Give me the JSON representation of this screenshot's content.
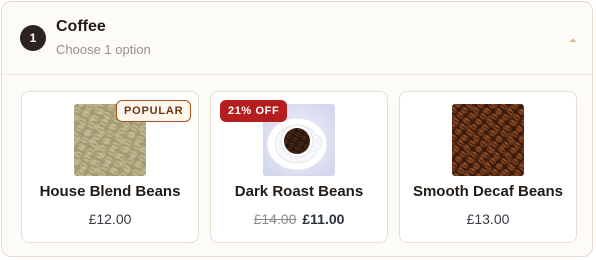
{
  "section": {
    "step_number": "1",
    "title": "Coffee",
    "subtitle": "Choose 1 option",
    "toggle_icon": "chevron-up-icon"
  },
  "products": [
    {
      "name": "House Blend Beans",
      "price": "£12.00",
      "badge": "POPULAR",
      "image": "green-coffee-beans"
    },
    {
      "name": "Dark Roast Beans",
      "old_price": "£14.00",
      "price": "£11.00",
      "badge": "21% OFF",
      "image": "coffee-cup-with-beans"
    },
    {
      "name": "Smooth Decaf Beans",
      "price": "£13.00",
      "image": "roasted-coffee-beans"
    }
  ],
  "colors": {
    "accent_dark": "#2c2320",
    "popular_badge_border": "#a5541f",
    "discount_badge": "#b51e1e",
    "panel_background": "#fdfbf8"
  }
}
